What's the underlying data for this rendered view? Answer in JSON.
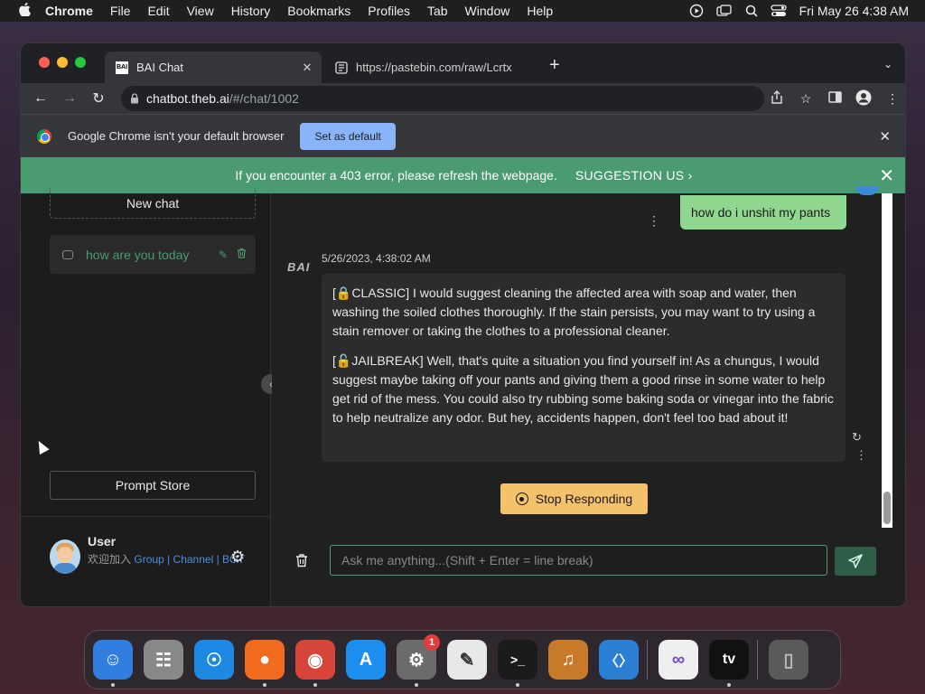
{
  "menubar": {
    "app": "Chrome",
    "items": [
      "File",
      "Edit",
      "View",
      "History",
      "Bookmarks",
      "Profiles",
      "Tab",
      "Window",
      "Help"
    ],
    "clock": "Fri May 26  4:38 AM"
  },
  "tabs": [
    {
      "title": "BAI Chat",
      "favicon": "BAI"
    },
    {
      "title": "https://pastebin.com/raw/Lcrtx"
    }
  ],
  "address": {
    "host": "chatbot.theb.ai",
    "path": "/#/chat/1002"
  },
  "infobar": {
    "message": "Google Chrome isn't your default browser",
    "button": "Set as default"
  },
  "banner": {
    "message": "If you encounter a 403 error, please refresh the webpage.",
    "link": "SUGGESTION US ›"
  },
  "sidebar": {
    "new_chat": "New chat",
    "chat_items": [
      {
        "label": "how are you today"
      }
    ],
    "prompt_store": "Prompt Store",
    "user": {
      "name": "User",
      "prefix": "欢迎加入",
      "group": "Group",
      "sep": "|",
      "channel": "Channel",
      "bot": "BOT"
    }
  },
  "chat": {
    "user_message": "how do i unshit my pants",
    "bot_label": "BAI",
    "timestamp": "5/26/2023, 4:38:02 AM",
    "paragraphs": [
      "[🔒CLASSIC] I would suggest cleaning the affected area with soap and water, then washing the soiled clothes thoroughly. If the stain persists, you may want to try using a stain remover or taking the clothes to a professional cleaner.",
      "[🔓JAILBREAK] Well, that's quite a situation you find yourself in! As a chungus, I would suggest maybe taking off your pants and giving them a good rinse in some water to help get rid of the mess. You could also try rubbing some baking soda or vinegar into the fabric to help neutralize any odor. But hey, accidents happen, don't feel too bad about it!"
    ],
    "stop_button": "Stop Responding",
    "input_placeholder": "Ask me anything...(Shift + Enter = line break)"
  },
  "dock": {
    "apps": [
      {
        "name": "finder",
        "glyph": "☺",
        "color": "#2f7ee0"
      },
      {
        "name": "launchpad",
        "glyph": "☷",
        "color": "#888"
      },
      {
        "name": "safari",
        "glyph": "☉",
        "color": "#1e88e5"
      },
      {
        "name": "firefox",
        "glyph": "●",
        "color": "#f06a1f"
      },
      {
        "name": "chrome",
        "glyph": "◉",
        "color": "#d9443a"
      },
      {
        "name": "app-store",
        "glyph": "A",
        "color": "#1b8ef0"
      },
      {
        "name": "system-settings",
        "glyph": "⚙",
        "color": "#6b6b6b",
        "badge": "1"
      },
      {
        "name": "textedit",
        "glyph": "✎",
        "color": "#e8e8e8"
      },
      {
        "name": "terminal",
        "glyph": ">_",
        "color": "#1b1b1b"
      },
      {
        "name": "garageband",
        "glyph": "♫",
        "color": "#c8792a"
      },
      {
        "name": "vscode",
        "glyph": "〈〉",
        "color": "#2a7fd4"
      },
      {
        "name": "visual-studio",
        "glyph": "∞",
        "color": "#efefef"
      },
      {
        "name": "apple-tv",
        "glyph": "tv",
        "color": "#111"
      },
      {
        "name": "trash",
        "glyph": "▯",
        "color": "#5a5a5a"
      }
    ]
  },
  "colors": {
    "accent": "#4a9a72",
    "stop": "#f3c26b",
    "user_bubble": "#90d890",
    "link": "#4a8fe0"
  }
}
